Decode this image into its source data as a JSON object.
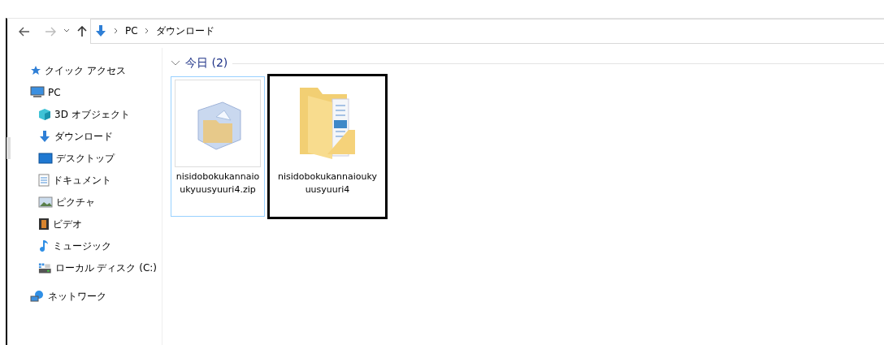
{
  "toolbar": {
    "back_enabled": true,
    "forward_enabled": false
  },
  "address_bar": {
    "crumbs": [
      "PC",
      "ダウンロード"
    ]
  },
  "sidebar": {
    "items": [
      {
        "label": "クイック アクセス"
      },
      {
        "label": "PC",
        "children": [
          {
            "label": "3D オブジェクト"
          },
          {
            "label": "ダウンロード"
          },
          {
            "label": "デスクトップ"
          },
          {
            "label": "ドキュメント"
          },
          {
            "label": "ピクチャ"
          },
          {
            "label": "ビデオ"
          },
          {
            "label": "ミュージック"
          },
          {
            "label": "ローカル ディスク (C:)"
          }
        ]
      },
      {
        "label": "ネットワーク"
      }
    ]
  },
  "group": {
    "title": "今日 (2)",
    "expanded": true
  },
  "files": [
    {
      "name": "nisidobokukannaioukyuusyuuri4.zip",
      "kind": "zip",
      "selected": true,
      "highlighted": false
    },
    {
      "name": "nisidobokukannaioukyuusyuuri4",
      "kind": "folder",
      "selected": false,
      "highlighted": true
    }
  ]
}
